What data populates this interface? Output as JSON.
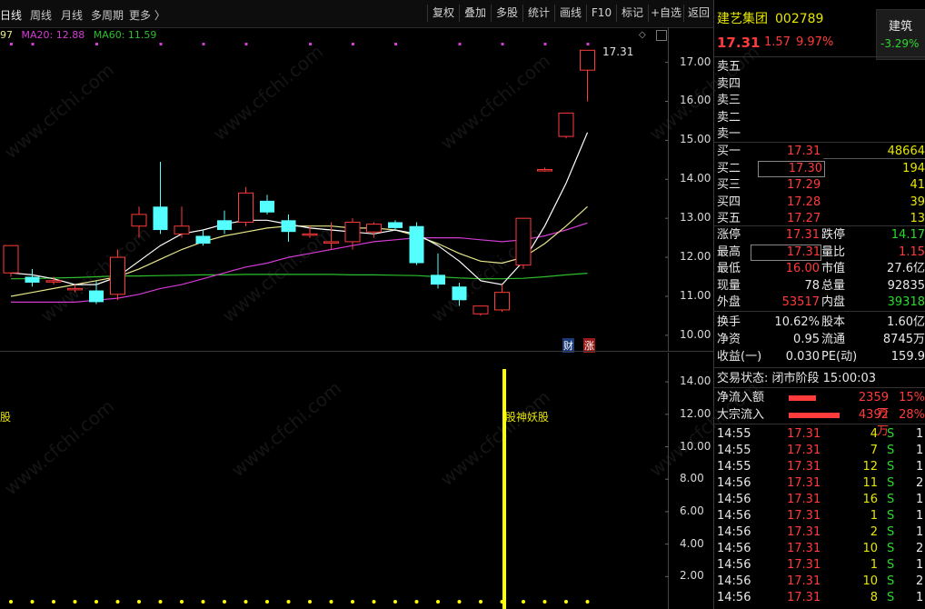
{
  "toolbar": {
    "tabs": [
      "日线",
      "周线",
      "月线",
      "多周期",
      "更多 〉"
    ],
    "buttons": [
      "复权",
      "叠加",
      "多股",
      "统计",
      "画线",
      "F10",
      "标记",
      "+自选",
      "返回"
    ]
  },
  "ma": {
    "ma10": "97",
    "ma20": "MA20: 12.88",
    "ma60": "MA60: 11.59"
  },
  "main_axis": [
    "17.00",
    "16.00",
    "15.00",
    "14.00",
    "13.00",
    "12.00",
    "11.00",
    "10.00"
  ],
  "sub_axis": [
    "14.00",
    "12.00",
    "10.00",
    "8.00",
    "6.00",
    "4.00",
    "2.00"
  ],
  "last_price_label": "17.31",
  "markers": {
    "cai": "财",
    "zhang": "涨"
  },
  "sub_labels": {
    "left": "股",
    "signal": "股神妖股"
  },
  "colors": {
    "up": "#ff3b3b",
    "down": "#54ffff",
    "ma5": "#ffffff",
    "ma10": "#e6e68a",
    "ma20": "#d43bd4",
    "ma60": "#2bbf2b",
    "signal": "#ffff00"
  },
  "stock": {
    "name": "建艺集团",
    "code": "002789",
    "price": "17.31",
    "change": "1.57",
    "change_pct": "9.97%",
    "sector": "建筑",
    "sector_pct": "-3.29%"
  },
  "sell_levels": [
    "卖五",
    "卖四",
    "卖三",
    "卖二",
    "卖一"
  ],
  "buy_levels": [
    {
      "label": "买一",
      "price": "17.31",
      "vol": "48664"
    },
    {
      "label": "买二",
      "price": "17.30",
      "vol": "194"
    },
    {
      "label": "买三",
      "price": "17.29",
      "vol": "41"
    },
    {
      "label": "买四",
      "price": "17.28",
      "vol": "39"
    },
    {
      "label": "买五",
      "price": "17.27",
      "vol": "13"
    }
  ],
  "stats": [
    {
      "l1": "涨停",
      "v1": "17.31",
      "c1": "red",
      "l2": "跌停",
      "v2": "14.17",
      "c2": "green"
    },
    {
      "l1": "最高",
      "v1": "17.31",
      "c1": "red",
      "l2": "量比",
      "v2": "1.15",
      "c2": "red"
    },
    {
      "l1": "最低",
      "v1": "16.00",
      "c1": "red",
      "l2": "市值",
      "v2": "27.6亿",
      "c2": "white"
    },
    {
      "l1": "现量",
      "v1": "78",
      "c1": "white",
      "l2": "总量",
      "v2": "92835",
      "c2": "white"
    },
    {
      "l1": "外盘",
      "v1": "53517",
      "c1": "red",
      "l2": "内盘",
      "v2": "39318",
      "c2": "green"
    }
  ],
  "stats2": [
    {
      "l1": "换手",
      "v1": "10.62%",
      "l2": "股本",
      "v2": "1.60亿"
    },
    {
      "l1": "净资",
      "v1": "0.95",
      "l2": "流通",
      "v2": "8745万"
    },
    {
      "l1": "收益(一)",
      "v1": "0.030",
      "l2": "PE(动)",
      "v2": "159.9"
    }
  ],
  "trade_status": "交易状态: 闭市阶段 15:00:03",
  "flows": [
    {
      "label": "净流入额",
      "amount": "2359万",
      "pct": "15%",
      "bar": 0.3
    },
    {
      "label": "大宗流入",
      "amount": "4392万",
      "pct": "28%",
      "bar": 0.56
    }
  ],
  "ticks": [
    {
      "t": "14:55",
      "p": "17.31",
      "v": "4",
      "s": "S",
      "x": "1"
    },
    {
      "t": "14:55",
      "p": "17.31",
      "v": "7",
      "s": "S",
      "x": "1"
    },
    {
      "t": "14:55",
      "p": "17.31",
      "v": "12",
      "s": "S",
      "x": "1"
    },
    {
      "t": "14:56",
      "p": "17.31",
      "v": "11",
      "s": "S",
      "x": "2"
    },
    {
      "t": "14:56",
      "p": "17.31",
      "v": "16",
      "s": "S",
      "x": "1"
    },
    {
      "t": "14:56",
      "p": "17.31",
      "v": "1",
      "s": "S",
      "x": "1"
    },
    {
      "t": "14:56",
      "p": "17.31",
      "v": "2",
      "s": "S",
      "x": "1"
    },
    {
      "t": "14:56",
      "p": "17.31",
      "v": "10",
      "s": "S",
      "x": "2"
    },
    {
      "t": "14:56",
      "p": "17.31",
      "v": "1",
      "s": "S",
      "x": "1"
    },
    {
      "t": "14:56",
      "p": "17.31",
      "v": "10",
      "s": "S",
      "x": "2"
    },
    {
      "t": "14:56",
      "p": "17.31",
      "v": "8",
      "s": "S",
      "x": "1"
    }
  ],
  "chart_data": {
    "type": "candlestick",
    "ylim": [
      9.6,
      17.9
    ],
    "candles": [
      {
        "o": 11.6,
        "h": 11.8,
        "c": 12.3,
        "l": 11.5
      },
      {
        "o": 11.5,
        "h": 11.7,
        "c": 11.35,
        "l": 11.25
      },
      {
        "o": 11.4,
        "h": 11.5,
        "c": 11.4,
        "l": 11.3
      },
      {
        "o": 11.2,
        "h": 11.3,
        "c": 11.2,
        "l": 11.1
      },
      {
        "o": 11.15,
        "h": 11.4,
        "c": 10.85,
        "l": 10.8
      },
      {
        "o": 11.05,
        "h": 12.2,
        "c": 12.0,
        "l": 10.9
      },
      {
        "o": 12.8,
        "h": 13.3,
        "c": 13.1,
        "l": 12.5
      },
      {
        "o": 13.3,
        "h": 14.45,
        "c": 12.7,
        "l": 12.6
      },
      {
        "o": 12.6,
        "h": 13.3,
        "c": 12.8,
        "l": 12.5
      },
      {
        "o": 12.55,
        "h": 12.7,
        "c": 12.35,
        "l": 12.3
      },
      {
        "o": 12.95,
        "h": 13.2,
        "c": 12.7,
        "l": 12.6
      },
      {
        "o": 12.9,
        "h": 13.8,
        "c": 13.65,
        "l": 12.8
      },
      {
        "o": 13.45,
        "h": 13.6,
        "c": 13.15,
        "l": 13.1
      },
      {
        "o": 12.95,
        "h": 13.1,
        "c": 12.65,
        "l": 12.4
      },
      {
        "o": 12.6,
        "h": 12.8,
        "c": 12.6,
        "l": 12.5
      },
      {
        "o": 12.4,
        "h": 12.9,
        "c": 12.4,
        "l": 12.2
      },
      {
        "o": 12.4,
        "h": 13.0,
        "c": 12.9,
        "l": 12.2
      },
      {
        "o": 12.65,
        "h": 12.9,
        "c": 12.85,
        "l": 12.5
      },
      {
        "o": 12.9,
        "h": 12.95,
        "c": 12.75,
        "l": 12.7
      },
      {
        "o": 12.8,
        "h": 12.9,
        "c": 11.85,
        "l": 11.8
      },
      {
        "o": 11.55,
        "h": 12.1,
        "c": 11.3,
        "l": 11.2
      },
      {
        "o": 11.25,
        "h": 11.35,
        "c": 10.9,
        "l": 10.75
      },
      {
        "o": 10.55,
        "h": 10.7,
        "c": 10.75,
        "l": 10.5
      },
      {
        "o": 10.65,
        "h": 11.3,
        "c": 11.1,
        "l": 10.6
      },
      {
        "o": 11.8,
        "h": 12.5,
        "c": 13.0,
        "l": 11.7
      },
      {
        "o": 14.25,
        "h": 14.3,
        "c": 14.25,
        "l": 14.2
      },
      {
        "o": 15.1,
        "h": 15.7,
        "c": 15.7,
        "l": 15.05
      },
      {
        "o": 16.8,
        "h": 17.31,
        "c": 17.31,
        "l": 16.0
      }
    ],
    "ma5": [
      11.6,
      11.55,
      11.45,
      11.3,
      11.3,
      11.5,
      11.9,
      12.3,
      12.6,
      12.7,
      12.85,
      12.95,
      12.95,
      12.85,
      12.75,
      12.7,
      12.65,
      12.6,
      12.7,
      12.6,
      12.3,
      11.9,
      11.4,
      11.3,
      11.9,
      12.8,
      13.9,
      15.2
    ],
    "ma10": [
      11.0,
      11.1,
      11.2,
      11.3,
      11.4,
      11.5,
      11.7,
      11.95,
      12.2,
      12.4,
      12.55,
      12.65,
      12.75,
      12.8,
      12.8,
      12.8,
      12.75,
      12.75,
      12.7,
      12.55,
      12.35,
      12.1,
      11.9,
      11.85,
      12.0,
      12.35,
      12.8,
      13.3
    ],
    "ma20": [
      10.85,
      10.85,
      10.85,
      10.85,
      10.9,
      10.95,
      11.05,
      11.2,
      11.3,
      11.45,
      11.6,
      11.75,
      11.85,
      12.0,
      12.1,
      12.2,
      12.3,
      12.4,
      12.45,
      12.5,
      12.5,
      12.5,
      12.45,
      12.4,
      12.45,
      12.55,
      12.7,
      12.88
    ],
    "ma60": [
      11.45,
      11.45,
      11.47,
      11.48,
      11.5,
      11.52,
      11.52,
      11.53,
      11.54,
      11.55,
      11.55,
      11.56,
      11.56,
      11.56,
      11.56,
      11.56,
      11.55,
      11.55,
      11.54,
      11.53,
      11.5,
      11.47,
      11.45,
      11.45,
      11.46,
      11.5,
      11.55,
      11.59
    ]
  }
}
